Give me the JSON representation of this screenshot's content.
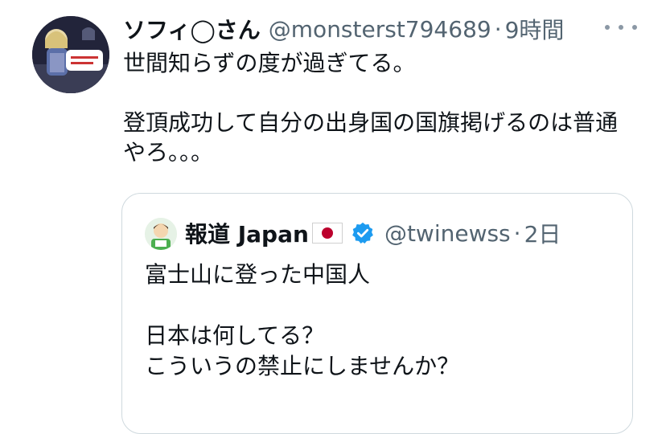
{
  "tweet": {
    "author_name": "ソフィ◯さん",
    "author_handle": "@monsterst794689",
    "separator": "·",
    "time": "9時間",
    "text": "世間知らずの度が過ぎてる。\n\n登頂成功して自分の出身国の国旗掲げるのは普通やろ。。。"
  },
  "quoted_tweet": {
    "author_name": "報道 Japan",
    "author_handle": "@twinewss",
    "separator": "·",
    "time": "2日",
    "text": "富士山に登った中国人\n\n日本は何してる？\nこういうの禁止にしませんか？"
  },
  "icons": {
    "more": "more-options-icon",
    "verified": "verified-badge-icon",
    "flag": "japan-flag-icon"
  },
  "colors": {
    "text": "#0f1419",
    "secondary": "#536471",
    "verified": "#1d9bf0",
    "border": "#cfd9de"
  }
}
